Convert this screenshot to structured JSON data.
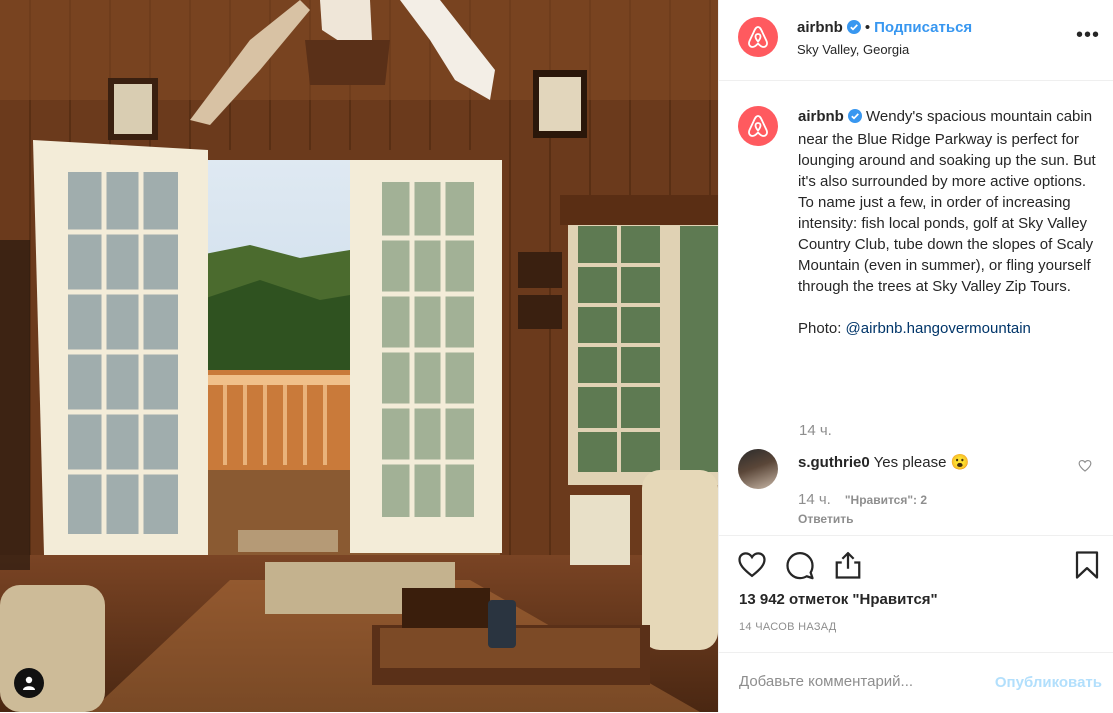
{
  "post": {
    "username": "airbnb",
    "follow_label": "Подписаться",
    "dot": "•",
    "location": "Sky Valley, Georgia",
    "more_label": "•••",
    "caption_text": "Wendy's spacious mountain cabin near the Blue Ridge Parkway is perfect for lounging around and soaking up the sun. But it's also surrounded by more active options. To name just a few, in order of increasing intensity: fish local ponds, golf at Sky Valley Country Club, tube down the slopes of Scaly Mountain (even in summer), or fling yourself through the trees at Sky Valley Zip Tours.",
    "caption_photo_prefix": "Photo: ",
    "caption_photo_handle": "@airbnb.hangovermountain",
    "caption_time": "14 ч.",
    "likes_count": "13 942 отметок \"Нравится\"",
    "time_ago": "14 ЧАСОВ НАЗАД"
  },
  "comment": {
    "username": "s.guthrie0",
    "text": "Yes please",
    "emoji": "😮",
    "time": "14 ч.",
    "likes": "\"Нравится\": 2",
    "reply_label": "Ответить"
  },
  "add_comment": {
    "placeholder": "Добавьте комментарий...",
    "publish_label": "Опубликовать"
  },
  "colors": {
    "brand": "#ff5a5f",
    "link": "#3897f0",
    "verified": "#3897f0",
    "publish_disabled": "#b2dffc"
  },
  "icons": [
    "airbnb-logo-icon",
    "verified-badge-icon",
    "heart-icon",
    "comment-icon",
    "share-icon",
    "bookmark-icon",
    "user-icon",
    "more-icon"
  ]
}
